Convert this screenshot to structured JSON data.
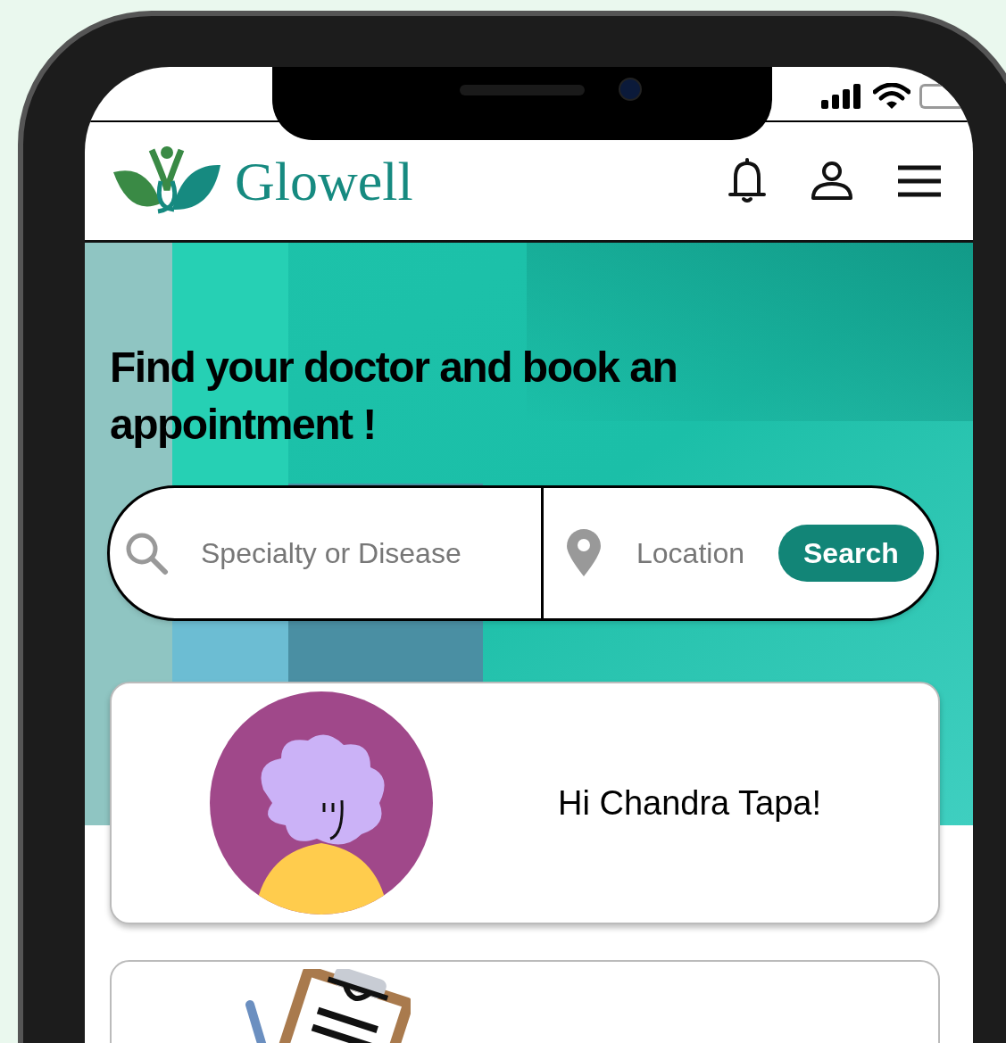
{
  "app": {
    "name": "Glowell"
  },
  "hero": {
    "heading": "Find your doctor and book an appointment !"
  },
  "search": {
    "specialty_placeholder": "Specialty or Disease",
    "location_placeholder": "Location",
    "button": "Search"
  },
  "greeting_card": {
    "text": "Hi Chandra Tapa!"
  }
}
